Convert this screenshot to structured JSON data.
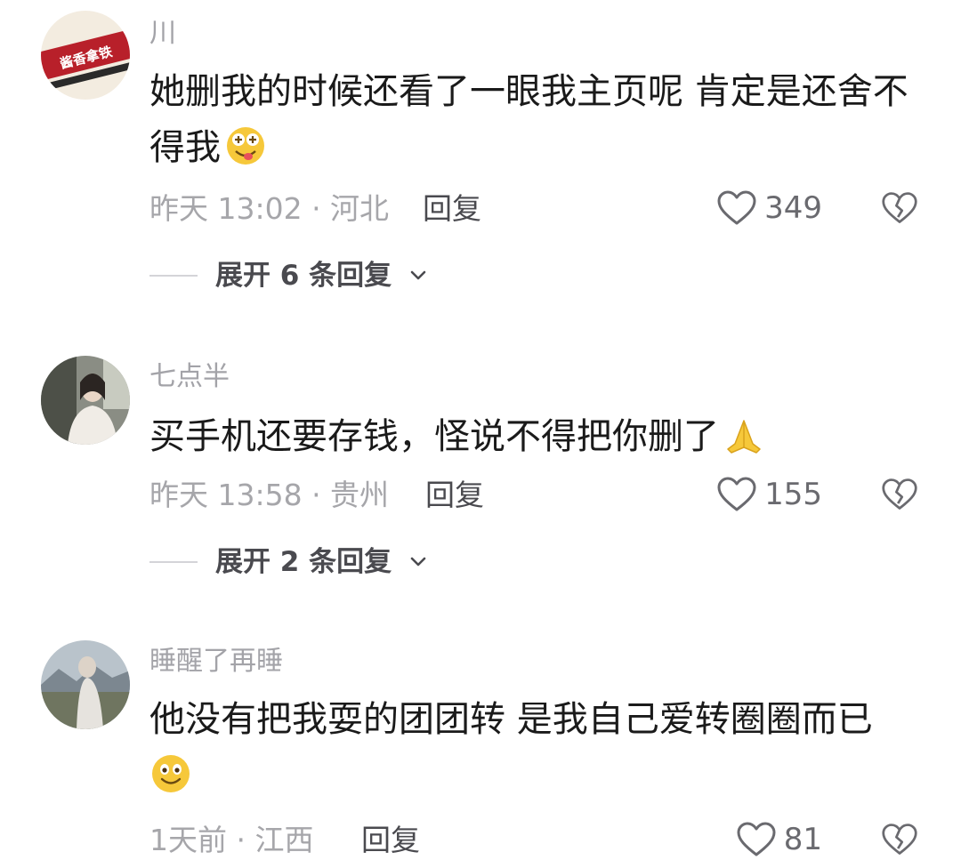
{
  "comments": [
    {
      "username": "川",
      "avatar_text": "酱香拿铁",
      "content_line1": "她删我的时候还看了一眼我主页呢 肯定是还舍不",
      "content_line2": "得我",
      "emoji": "drooling-face-emoji",
      "meta": "昨天 13:02 · 河北",
      "reply_label": "回复",
      "likes": "349",
      "expand_label": "展开 6 条回复"
    },
    {
      "username": "七点半",
      "avatar_text": "",
      "content_line1": "买手机还要存钱，怪说不得把你删了",
      "emoji": "praying-hands-emoji",
      "meta": "昨天 13:58 · 贵州",
      "reply_label": "回复",
      "likes": "155",
      "expand_label": "展开 2 条回复"
    },
    {
      "username": "睡醒了再睡",
      "avatar_text": "",
      "content_line1": "他没有把我耍的团团转 是我自己爱转圈圈而已",
      "emoji": "smiling-face-emoji",
      "meta": "1天前 · 江西",
      "reply_label": "回复",
      "likes": "81"
    }
  ],
  "colors": {
    "username": "#a3a3a8",
    "content": "#1a1a1a",
    "meta": "#a6a6aa",
    "reply": "#4a4a4f",
    "avatar1_bg": "#b8202a",
    "emoji_yellow": "#f6c83a"
  }
}
